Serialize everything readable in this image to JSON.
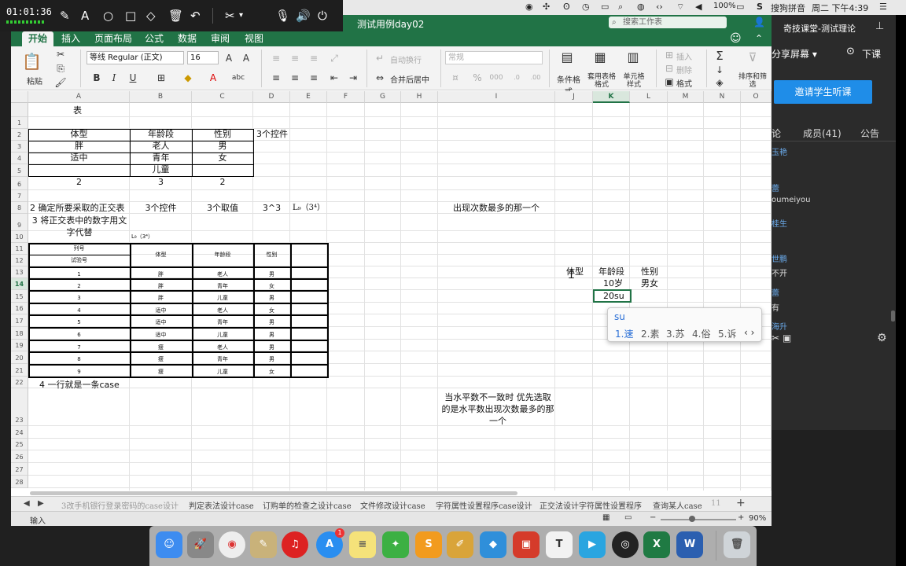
{
  "recorder": {
    "time": "01:01:36"
  },
  "menubar": {
    "battery": "100%",
    "ime": "搜狗拼音",
    "clock": "周二 下午4:39"
  },
  "excel": {
    "filename": "测试用例day02",
    "search_placeholder": "搜索工作表",
    "tabs": [
      "开始",
      "插入",
      "页面布局",
      "公式",
      "数据",
      "审阅",
      "视图"
    ],
    "ribbon": {
      "paste": "粘贴",
      "font_name": "等线 Regular (正文)",
      "font_size": "16",
      "bold": "B",
      "italic": "I",
      "underline": "U",
      "wrap": "自动换行",
      "merge": "合并后居中",
      "number_format": "常规",
      "cond_format": "条件格式",
      "table_format": "套用表格格式",
      "cell_style": "单元格样式",
      "insert": "插入",
      "delete": "删除",
      "format": "格式",
      "sort": "排序和筛选"
    },
    "columns": [
      "A",
      "B",
      "C",
      "D",
      "E",
      "F",
      "G",
      "H",
      "I",
      "J",
      "K",
      "L",
      "M",
      "N",
      "O"
    ],
    "rows": [
      "",
      "1",
      "2",
      "3",
      "4",
      "5",
      "6",
      "7",
      "8",
      "9",
      "10",
      "11",
      "12",
      "13",
      "14",
      "15",
      "16",
      "17",
      "18",
      "19",
      "20",
      "21",
      "22",
      "23",
      "24",
      "25",
      "26",
      "27",
      "28"
    ],
    "cells": {
      "a0": "表",
      "r2": [
        "体型",
        "年龄段",
        "性别",
        "3个控件"
      ],
      "r3": [
        "胖",
        "老人",
        "男"
      ],
      "r4": [
        "适中",
        "青年",
        "女"
      ],
      "r5b": "儿童",
      "r6": [
        "2",
        "3",
        "2"
      ],
      "r8": [
        "2 确定所要采取的正交表",
        "3个控件",
        "3个取值",
        "3^3",
        "L₉（3⁴）"
      ],
      "r8i": "出现次数最多的那一个",
      "r9a": "3 将正交表中的数字用文字代替",
      "r9b": "L₉（3⁴）",
      "r10a": "列号",
      "r11a": "试验号",
      "r10h": [
        "体型",
        "年龄段",
        "性别"
      ],
      "table": [
        [
          "1",
          "胖",
          "老人",
          "男"
        ],
        [
          "2",
          "胖",
          "青年",
          "女"
        ],
        [
          "3",
          "胖",
          "儿童",
          "男"
        ],
        [
          "4",
          "适中",
          "老人",
          "女"
        ],
        [
          "5",
          "适中",
          "青年",
          "男"
        ],
        [
          "6",
          "适中",
          "儿童",
          "男"
        ],
        [
          "7",
          "瘦",
          "老人",
          "男"
        ],
        [
          "8",
          "瘦",
          "青年",
          "男"
        ],
        [
          "9",
          "瘦",
          "儿童",
          "女"
        ]
      ],
      "r21": "4 一行就是一条case",
      "i22": "当水平数不一致时 优先选取的是水平数出现次数最多的那一个",
      "j12": "体型",
      "k12": "年龄段",
      "l12": "性别",
      "k13": "10岁",
      "l13": "男女",
      "k14": "20su"
    },
    "ime": {
      "input": "su",
      "candidates": [
        "1.速",
        "2.素",
        "3.苏",
        "4.俗",
        "5.诉"
      ]
    },
    "sheet_tabs": [
      "3改手机银行登录密码的case设计",
      "判定表法设计case",
      "订购单的检查之设计case",
      "文件修改设计case",
      "字符属性设置程序case设计",
      "正交法设计字符属性设置程序",
      "查询某人case",
      "11"
    ],
    "status": {
      "mode": "输入",
      "zoom": "90%"
    }
  },
  "panel": {
    "title": "奇技课堂-测试理论",
    "share": "分享屏幕",
    "next": "下课",
    "invite": "邀请学生听课",
    "tab_discuss": "论",
    "tab_members": "成员(41)",
    "tab_notice": "公告",
    "list": [
      "玉艳",
      "蕾",
      "oumeiyou",
      "桂生",
      "世鹏",
      "不开",
      "蕾",
      "有",
      "海升"
    ]
  },
  "colors": {
    "excel_green": "#217346",
    "accent_blue": "#1f8de8"
  }
}
